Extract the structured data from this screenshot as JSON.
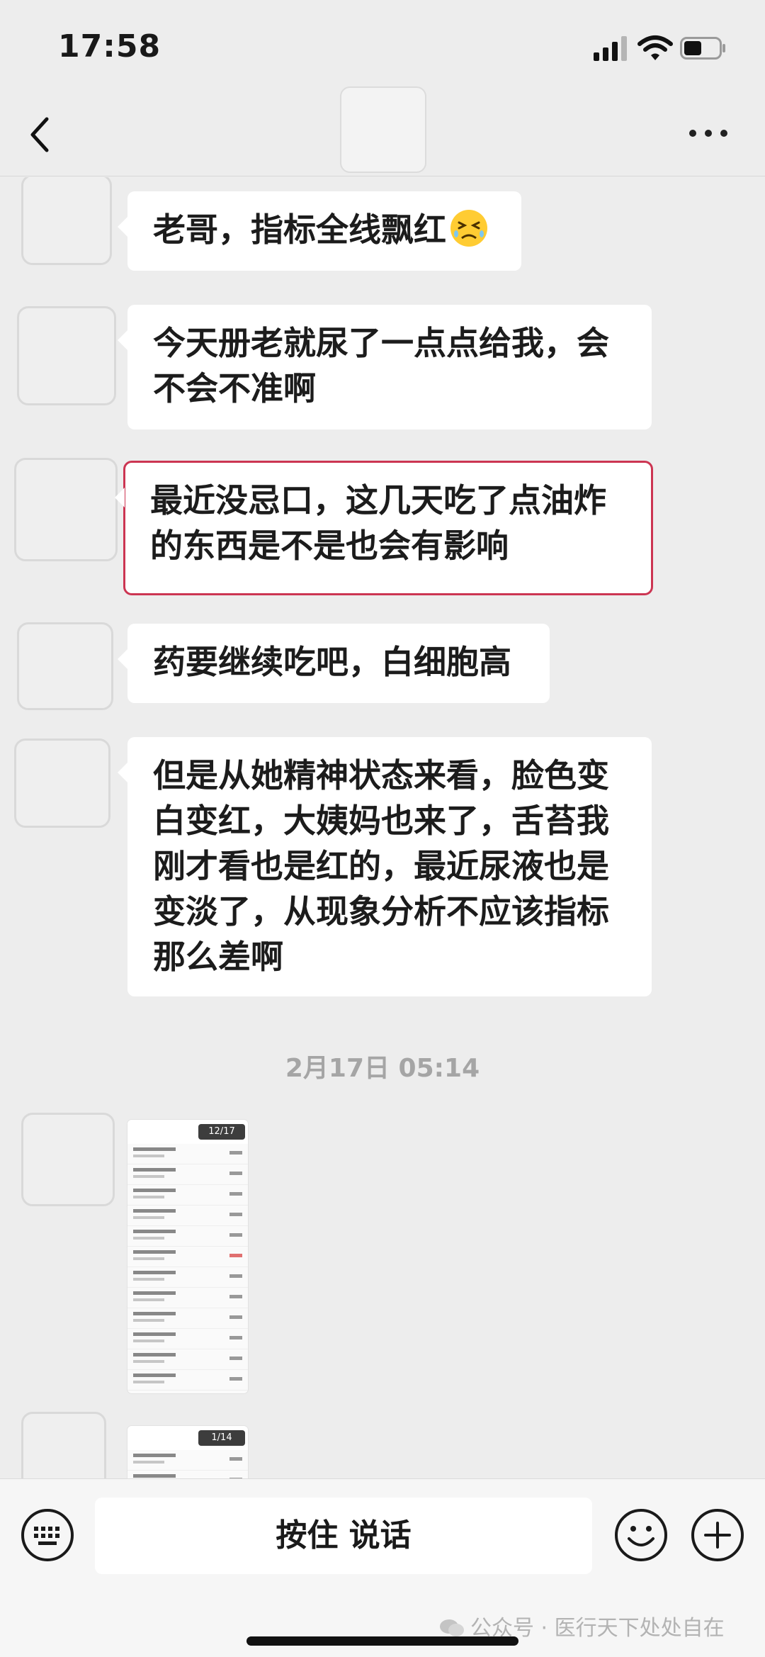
{
  "status_bar": {
    "time": "17:58"
  },
  "messages": [
    {
      "text": "老哥，指标全线飘红"
    },
    {
      "text": "今天册老就尿了一点点给我，会不会不准啊"
    },
    {
      "text": "最近没忌口，这几天吃了点油炸的东西是不是也会有影响"
    },
    {
      "text": "药要继续吃吧，白细胞高"
    },
    {
      "text": "但是从她精神状态来看，脸色变白变红，大姨妈也来了，舌苔我刚才看也是红的，最近尿液也是变淡了，从现象分析不应该指标那么差啊"
    }
  ],
  "timestamp": "2月17日 05:14",
  "images": [
    {
      "page": "12/17"
    },
    {
      "page": "1/14"
    }
  ],
  "input": {
    "voice_label": "按住 说话"
  },
  "watermark": "公众号 · 医行天下处处自在",
  "colors": {
    "highlight": "#cc3552",
    "background": "#ededed"
  }
}
